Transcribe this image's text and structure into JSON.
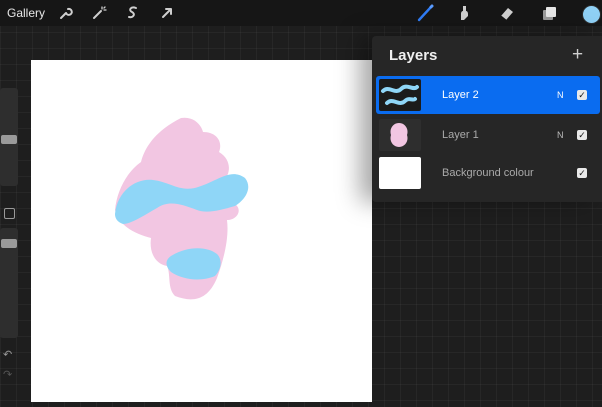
{
  "toolbar": {
    "gallery_label": "Gallery",
    "left_tools": [
      "wrench-icon",
      "magic-wand-icon",
      "selection-icon",
      "transform-arrow-icon"
    ],
    "right_tools": [
      "brush-icon",
      "smudge-icon",
      "eraser-icon",
      "layers-icon"
    ],
    "active_tool": "brush-icon",
    "active_color": "#8fd0f5",
    "accent_color": "#2f7cf6"
  },
  "sidebar": {
    "size_icon": "brush-size-slider",
    "opacity_icon": "opacity-slider",
    "modifier_icon": "modifier-square-icon",
    "undo_icon": "undo-icon",
    "redo_icon": "redo-icon"
  },
  "layers_panel": {
    "title": "Layers",
    "add_icon": "+",
    "layers": [
      {
        "name": "Layer 2",
        "blend_mode": "N",
        "visible": true,
        "selected": true,
        "thumbnail": "blue-wave-stroke"
      },
      {
        "name": "Layer 1",
        "blend_mode": "N",
        "visible": true,
        "selected": false,
        "thumbnail": "pink-blob"
      },
      {
        "name": "Background colour",
        "blend_mode": "",
        "visible": true,
        "selected": false,
        "thumbnail": "white-fill"
      }
    ]
  },
  "canvas": {
    "background": "#ffffff",
    "pink_color": "#f2c6e2",
    "blue_color": "#8fd6f7"
  }
}
